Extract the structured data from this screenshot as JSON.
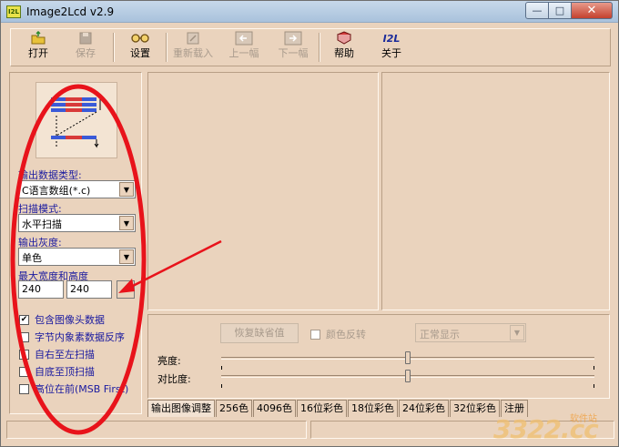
{
  "window": {
    "icon_text": "I2L",
    "title": "Image2Lcd v2.9",
    "close_glyph": "✕",
    "min_glyph": "—",
    "max_glyph": "□"
  },
  "toolbar": {
    "open": "打开",
    "save": "保存",
    "settings": "设置",
    "reload": "重新载入",
    "prev": "上一幅",
    "next": "下一幅",
    "help": "帮助",
    "about": "关于",
    "about_icon_text": "I2L"
  },
  "left": {
    "output_type_label": "输出数据类型:",
    "output_type_value": "C语言数组(*.c)",
    "scan_mode_label": "扫描模式:",
    "scan_mode_value": "水平扫描",
    "gray_label": "输出灰度:",
    "gray_value": "单色",
    "max_size_label": "最大宽度和高度",
    "max_width": "240",
    "max_height": "240",
    "checks": [
      {
        "label": "包含图像头数据",
        "checked": true
      },
      {
        "label": "字节内象素数据反序",
        "checked": false
      },
      {
        "label": "自右至左扫描",
        "checked": false
      },
      {
        "label": "自底至顶扫描",
        "checked": false
      },
      {
        "label": "高位在前(MSB First)",
        "checked": false
      }
    ],
    "check_mark": "✔"
  },
  "adjust": {
    "restore_button": "恢复缺省值",
    "invert_label": "颜色反转",
    "mode_value": "正常显示",
    "brightness_label": "亮度:",
    "contrast_label": "对比度:",
    "brightness_level": 0.5,
    "contrast_level": 0.5
  },
  "tabs": [
    "输出图像调整",
    "256色",
    "4096色",
    "16位彩色",
    "18位彩色",
    "24位彩色",
    "32位彩色",
    "注册"
  ],
  "watermark": {
    "number": "3322.cc",
    "site": "软件站"
  },
  "colors": {
    "window_bg": "#ead3bd",
    "label_blue": "#1a1aa0",
    "annotation_red": "#e8131b"
  }
}
